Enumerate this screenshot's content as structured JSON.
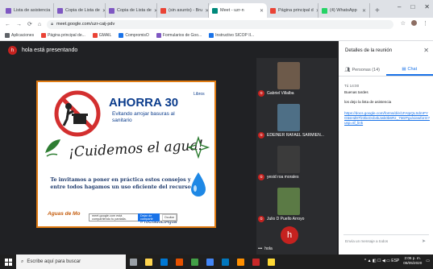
{
  "browser": {
    "tabs": [
      {
        "label": "Lista de asistencia",
        "color": "#7e57c2"
      },
      {
        "label": "Copia de Lista de",
        "color": "#7e57c2"
      },
      {
        "label": "Copia de Lista de",
        "color": "#7e57c2"
      },
      {
        "label": "(sin asunto) - Bru",
        "color": "#ea4335"
      },
      {
        "label": "Meet - uzr-n",
        "color": "#00897b",
        "active": true
      },
      {
        "label": "Página principal d",
        "color": "#ea4335"
      },
      {
        "label": "(4) WhatsApp",
        "color": "#25d366"
      }
    ],
    "new_tab": "+",
    "window_controls": [
      "–",
      "□",
      "✕"
    ],
    "url": "meet.google.com/uzr-caij-pdv",
    "bookmarks": [
      {
        "label": "Aplicaciones",
        "color": "#5f6368"
      },
      {
        "label": "Página principal de...",
        "color": "#ea4335"
      },
      {
        "label": "GMAIL",
        "color": "#ea4335"
      },
      {
        "label": "CompromisO",
        "color": "#1a73e8"
      },
      {
        "label": "Formularios de Goo...",
        "color": "#7e57c2"
      },
      {
        "label": "Instructivo SICOP II...",
        "color": "#1a73e8"
      }
    ]
  },
  "meet": {
    "presenter_initial": "h",
    "presenting_text": "hola está presentando",
    "slide": {
      "ahorra": "AHORRA 30",
      "libros": "Libros",
      "sub": "Evitando arrojar basuras al sanitario",
      "cuidemos": "¡Cuidemos el agua!",
      "body": "Te invitamos a poner en práctica estos consejos y entre todos hagamos un uso eficiente del recurso",
      "brand": "Aguas de Mo",
      "hashtag": "#YoCuidoElAgua"
    },
    "share_bar": {
      "text": "meet.google.com está compartiendo tu pantalla.",
      "stop": "Dejar de compartir",
      "hide": "Ocultar"
    },
    "participants": [
      {
        "name": "Gabriel Villalba",
        "photo": "#6d5a4a"
      },
      {
        "name": "EDEINER RAFAEL SARMIEN...",
        "photo": "#4e6f86"
      },
      {
        "name": "yesid roa morales",
        "photo": "#3b3b3b"
      },
      {
        "name": "Julio D Puello Arroyo",
        "photo": "#5b7a45"
      }
    ],
    "self": {
      "initial": "h",
      "name": "hola",
      "more": "•••"
    }
  },
  "side_panel": {
    "title": "Detalles de la reunión",
    "close": "✕",
    "tab_people": "Personas (14)",
    "tab_chat": "Chat",
    "messages": [
      {
        "meta": "Tú  14:00",
        "text": "Buenas tardes"
      },
      {
        "meta": "",
        "text": "los dejo la lista de asistencia"
      },
      {
        "meta": "",
        "link": "https://docs.google.com/forms/d/e/1FAIpQLSdmPYG5sHd97fz3bcDcb4kJwk0b6Rz_7MzPgx/viewform?usp=sf_link"
      }
    ],
    "input_placeholder": "Envía un mensaje a todos",
    "send": "➤"
  },
  "taskbar": {
    "search_placeholder": "Escribe aquí para buscar",
    "apps": [
      "#9aa0a6",
      "#ffd54f",
      "#0078d4",
      "#e65100",
      "#43a047",
      "#4285f4",
      "#0277bd",
      "#ff8f00",
      "#c62828",
      "#fdd835"
    ],
    "time": "2:06 p. m.",
    "date": "06/05/2020",
    "tray": "^ ▲ ◧ ☐ ◀ ▭ ESP"
  },
  "colors": {
    "accent": "#1a73e8",
    "danger": "#c5221f",
    "slide_border": "#e07b12"
  }
}
